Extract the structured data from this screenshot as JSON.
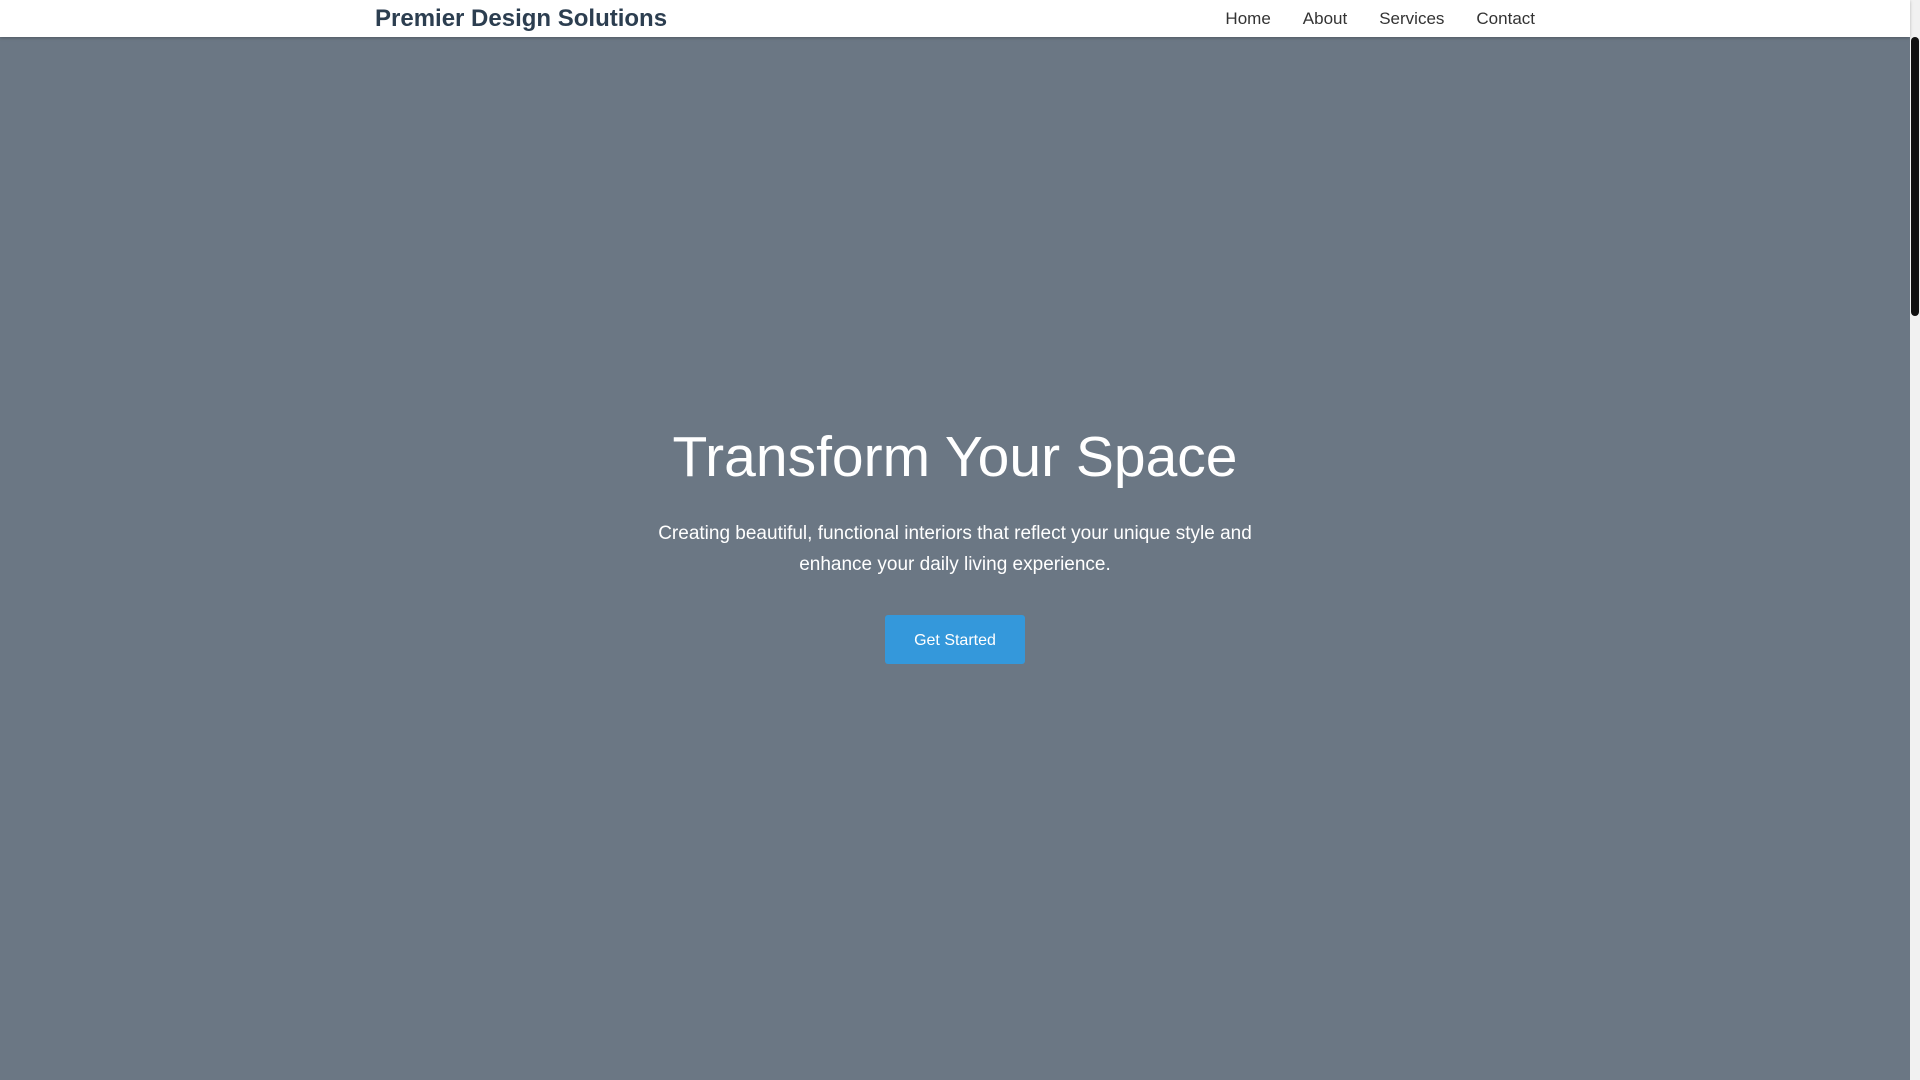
{
  "nav": {
    "brand": "Premier Design Solutions",
    "links": [
      {
        "label": "Home"
      },
      {
        "label": "About"
      },
      {
        "label": "Services"
      },
      {
        "label": "Contact"
      }
    ]
  },
  "hero": {
    "title": "Transform Your Space",
    "subtitle": "Creating beautiful, functional interiors that reflect your unique style and enhance your daily living experience.",
    "cta_label": "Get Started"
  },
  "colors": {
    "hero_bg": "#6b7784",
    "brand": "#2c3e50",
    "accent": "#3498db"
  }
}
